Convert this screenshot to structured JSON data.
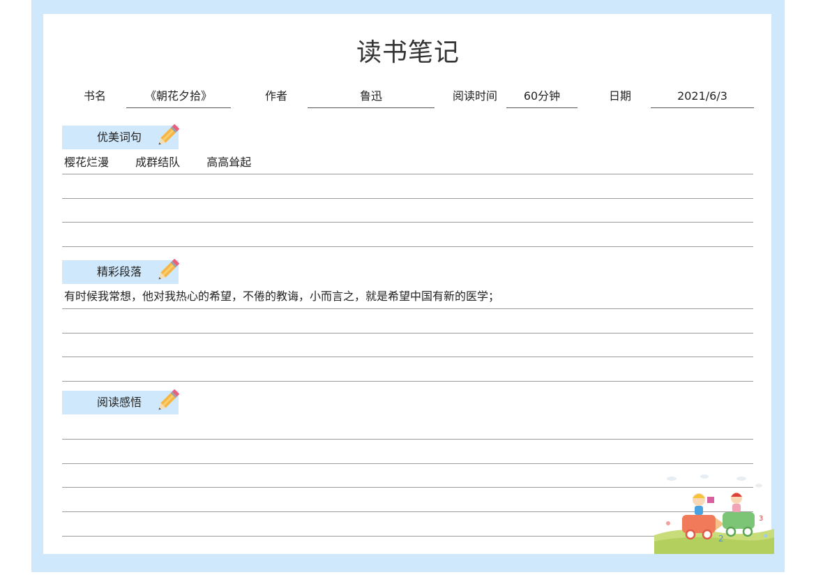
{
  "title": "读书笔记",
  "info": {
    "book_label": "书名",
    "book_value": "《朝花夕拾》",
    "author_label": "作者",
    "author_value": "鲁迅",
    "time_label": "阅读时间",
    "time_value": "60分钟",
    "date_label": "日期",
    "date_value": "2021/6/3"
  },
  "sections": {
    "phrases": {
      "label": "优美词句",
      "items": [
        "樱花烂漫",
        "成群结队",
        "高高耸起"
      ],
      "icon": "pencil-icon"
    },
    "passage": {
      "label": "精彩段落",
      "text": "有时候我常想，他对我热心的希望，不倦的教诲，小而言之，就是希望中国有新的医学；",
      "icon": "pencil-icon"
    },
    "reflection": {
      "label": "阅读感悟",
      "icon": "pencil-icon"
    }
  },
  "colors": {
    "frame": "#cfe8fb",
    "tab": "#cfe8fb"
  }
}
